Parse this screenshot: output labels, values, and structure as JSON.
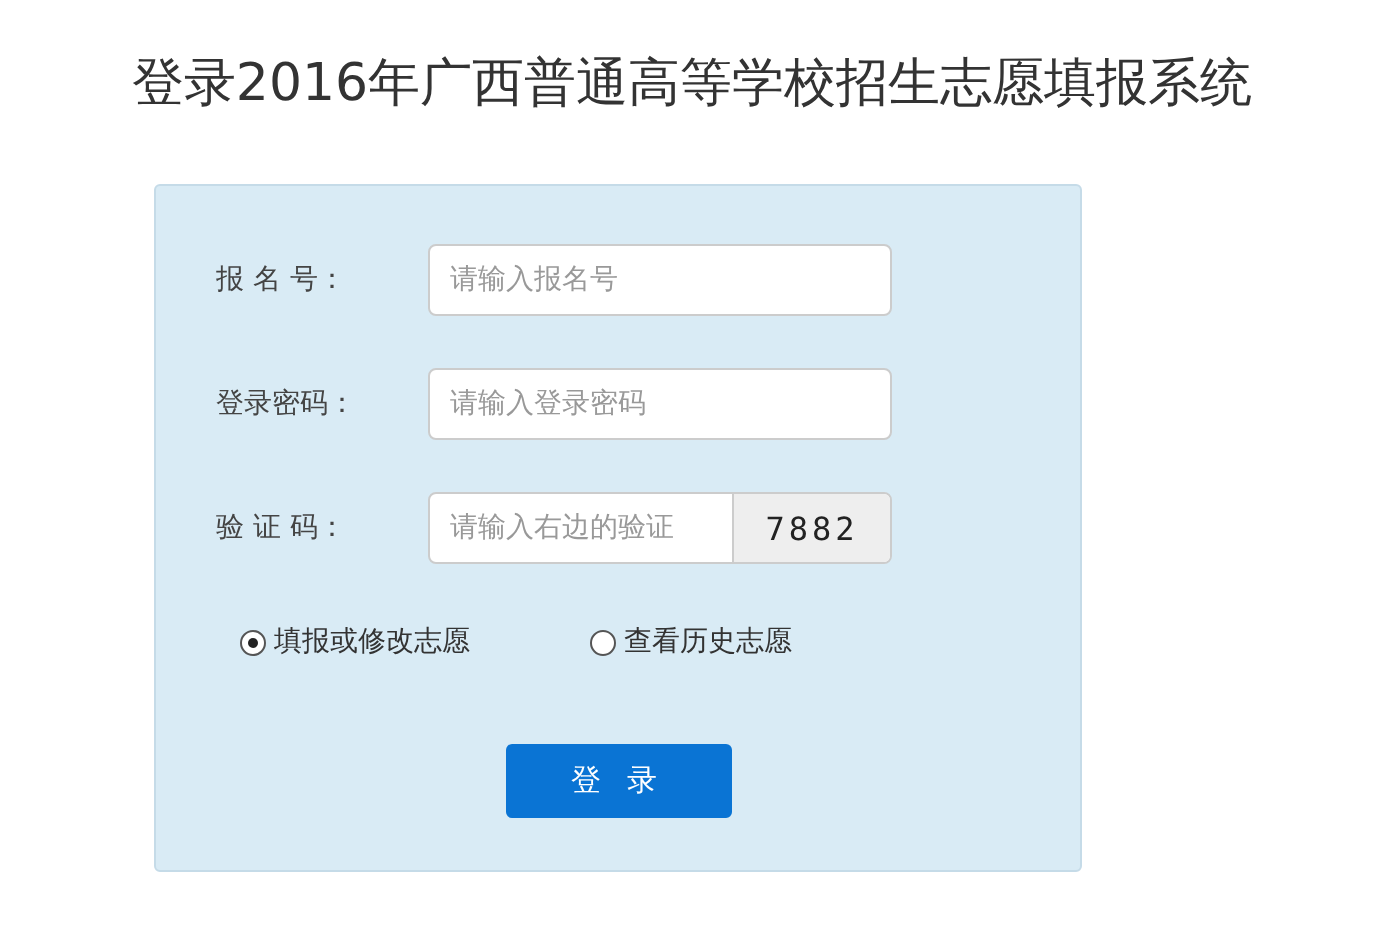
{
  "title": "登录2016年广西普通高等学校招生志愿填报系统",
  "fields": [
    {
      "label": "报 名 号：",
      "placeholder": "请输入报名号",
      "kind": "text"
    },
    {
      "label": "登录密码：",
      "placeholder": "请输入登录密码",
      "kind": "text"
    },
    {
      "label": "验 证 码：",
      "placeholder": "请输入右边的验证",
      "kind": "captcha",
      "captcha": "7882"
    }
  ],
  "options": [
    {
      "label": "填报或修改志愿",
      "selected": true
    },
    {
      "label": "查看历史志愿",
      "selected": false
    }
  ],
  "button": "登 录"
}
